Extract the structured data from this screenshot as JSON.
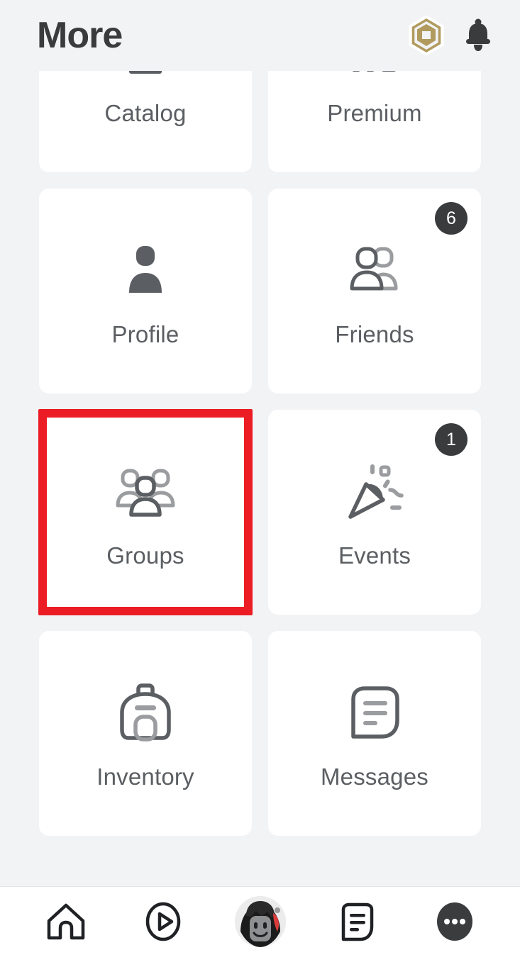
{
  "header": {
    "title": "More",
    "robux_icon": "robux-icon",
    "notification_icon": "bell-icon"
  },
  "colors": {
    "page_background": "#f2f3f5",
    "tile_background": "#ffffff",
    "label_text": "#5b5e62",
    "title_text": "#393b3d",
    "badge_background": "#393b3d",
    "badge_text": "#ffffff",
    "highlight_border": "#ec1c24",
    "robux_gold": "#b09a5e",
    "icon_stroke": "#5b5e62",
    "icon_stroke_light": "#9a9c9f"
  },
  "grid": {
    "tiles": [
      {
        "label": "Catalog",
        "icon": "catalog-icon",
        "badge": null,
        "highlighted": false
      },
      {
        "label": "Premium",
        "icon": "premium-icon",
        "badge": null,
        "highlighted": false
      },
      {
        "label": "Profile",
        "icon": "profile-icon",
        "badge": null,
        "highlighted": false
      },
      {
        "label": "Friends",
        "icon": "friends-icon",
        "badge": "6",
        "highlighted": false
      },
      {
        "label": "Groups",
        "icon": "groups-icon",
        "badge": null,
        "highlighted": true
      },
      {
        "label": "Events",
        "icon": "events-icon",
        "badge": "1",
        "highlighted": false
      },
      {
        "label": "Inventory",
        "icon": "inventory-icon",
        "badge": null,
        "highlighted": false
      },
      {
        "label": "Messages",
        "icon": "messages-icon",
        "badge": null,
        "highlighted": false
      }
    ]
  },
  "bottom_nav": {
    "items": [
      {
        "name": "home",
        "icon": "home-icon",
        "active": false
      },
      {
        "name": "discover",
        "icon": "play-circle-icon",
        "active": false
      },
      {
        "name": "avatar",
        "icon": "avatar-image",
        "active": false
      },
      {
        "name": "chat",
        "icon": "chat-icon",
        "active": false
      },
      {
        "name": "more",
        "icon": "ellipsis-icon",
        "active": true
      }
    ]
  }
}
